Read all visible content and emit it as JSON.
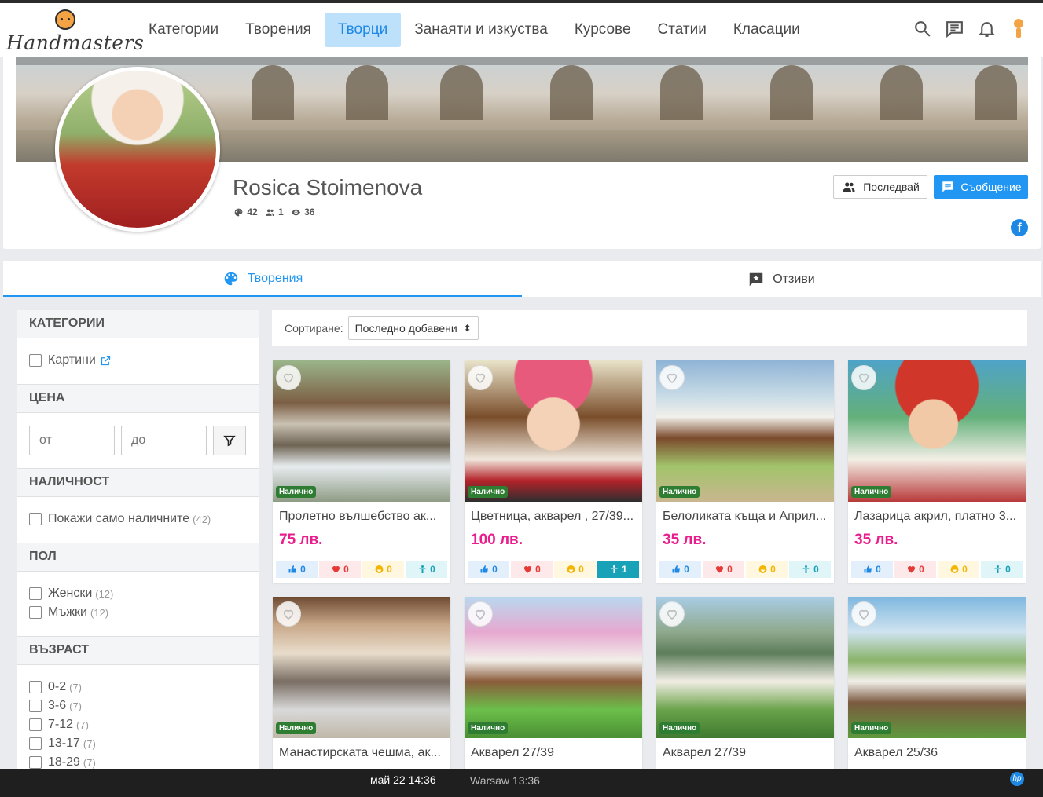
{
  "nav": {
    "logo_text": "Handmasters",
    "menu": [
      {
        "label": "Категории"
      },
      {
        "label": "Творения"
      },
      {
        "label": "Творци"
      },
      {
        "label": "Занаяти и изкуства"
      },
      {
        "label": "Курсове"
      },
      {
        "label": "Статии"
      },
      {
        "label": "Класации"
      }
    ],
    "active_index": 2
  },
  "profile": {
    "name": "Rosica Stoimenova",
    "stats": {
      "creations": "42",
      "followers": "1",
      "views": "36"
    },
    "follow_label": "Последвай",
    "message_label": "Съобщение"
  },
  "tabs": [
    {
      "label": "Творения"
    },
    {
      "label": "Отзиви"
    }
  ],
  "filters": {
    "categories_title": "КАТЕГОРИИ",
    "category": "Картини",
    "price_title": "ЦЕНА",
    "price_from_placeholder": "от",
    "price_to_placeholder": "до",
    "availability_title": "НАЛИЧНОСТ",
    "availability_label": "Покажи само наличните",
    "availability_count": "(42)",
    "gender_title": "ПОЛ",
    "genders": [
      {
        "label": "Женски",
        "count": "(12)"
      },
      {
        "label": "Мъжки",
        "count": "(12)"
      }
    ],
    "age_title": "ВЪЗРАСТ",
    "ages": [
      {
        "label": "0-2",
        "count": "(7)"
      },
      {
        "label": "3-6",
        "count": "(7)"
      },
      {
        "label": "7-12",
        "count": "(7)"
      },
      {
        "label": "13-17",
        "count": "(7)"
      },
      {
        "label": "18-29",
        "count": "(7)"
      }
    ]
  },
  "sort": {
    "label": "Сортиране:",
    "value": "Последно добавени"
  },
  "products": [
    {
      "title": "Пролетно вълшебство ак...",
      "price": "75 лв.",
      "badge": "Налично",
      "likes": "0",
      "loves": "0",
      "smiles": "0",
      "puppets": "0"
    },
    {
      "title": "Цветница, акварел , 27/39...",
      "price": "100 лв.",
      "badge": "Налично",
      "likes": "0",
      "loves": "0",
      "smiles": "0",
      "puppets": "1"
    },
    {
      "title": "Белоликата къща и Април...",
      "price": "35 лв.",
      "badge": "Налично",
      "likes": "0",
      "loves": "0",
      "smiles": "0",
      "puppets": "0"
    },
    {
      "title": "Лазарица акрил, платно 3...",
      "price": "35 лв.",
      "badge": "Налично",
      "likes": "0",
      "loves": "0",
      "smiles": "0",
      "puppets": "0"
    },
    {
      "title": "Манастирската чешма, ак...",
      "badge": "Налично"
    },
    {
      "title": "Акварел 27/39",
      "badge": "Налично"
    },
    {
      "title": "Акварел 27/39",
      "badge": "Налично"
    },
    {
      "title": "Акварел 25/36",
      "badge": "Налично"
    }
  ],
  "taskbar": {
    "datetime": "май 22  14:36",
    "tz": "Warsaw 13:36",
    "hp": "hp"
  },
  "colors": {
    "accent": "#2196f3",
    "price": "#e91e8c",
    "badge": "#2e7d32"
  }
}
